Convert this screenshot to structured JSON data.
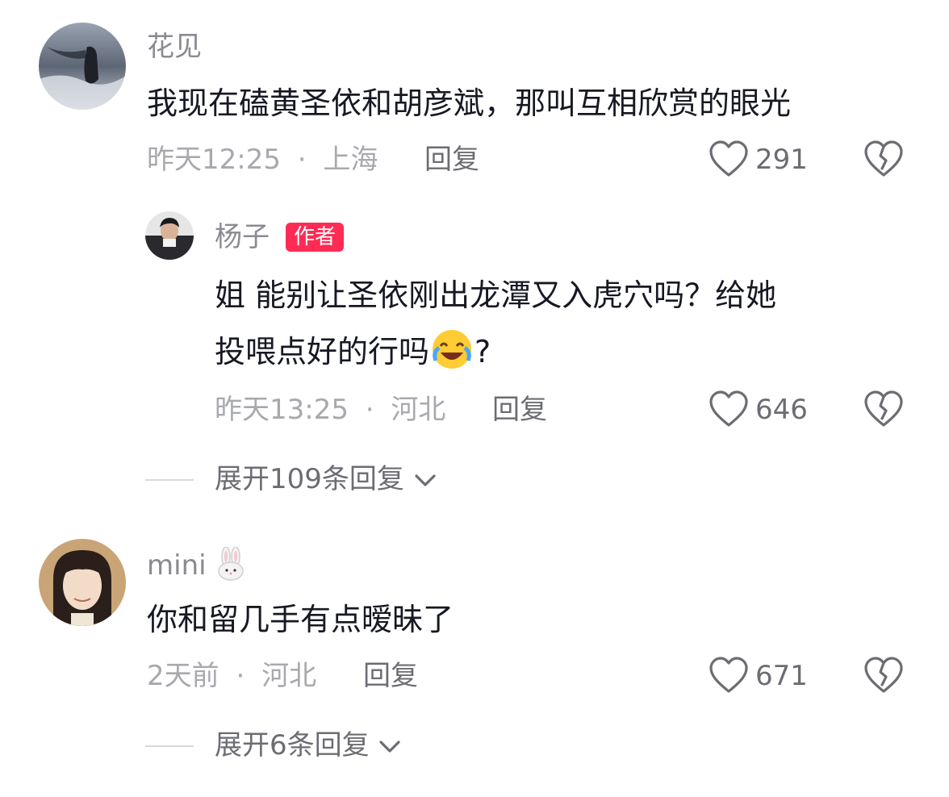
{
  "comments": [
    {
      "username": "花见",
      "text": "我现在磕黄圣依和胡彦斌，那叫互相欣赏的眼光",
      "time": "昨天12:25",
      "location": "上海",
      "reply_label": "回复",
      "likes": "291",
      "avatar": "silhouette-avatar",
      "replies": [
        {
          "username": "杨子",
          "badge": "作者",
          "text_line1": "姐 能别让圣依刚出龙潭又入虎穴吗？给她",
          "text_line2_before": "投喂点好的行吗",
          "emoji": "crying-laughing-emoji",
          "text_line2_after": "?",
          "time": "昨天13:25",
          "location": "河北",
          "reply_label": "回复",
          "likes": "646",
          "avatar": "man-portrait-avatar"
        }
      ],
      "expand_label": "展开109条回复"
    },
    {
      "username": "mini",
      "username_icon": "rabbit-emoji",
      "text": "你和留几手有点暧昧了",
      "time": "2天前",
      "location": "河北",
      "reply_label": "回复",
      "likes": "671",
      "avatar": "girl-portrait-avatar",
      "expand_label": "展开6条回复"
    }
  ],
  "separator": "·",
  "colors": {
    "text": "#161823",
    "meta": "#a8a9ae",
    "author_badge": "#fe2c55"
  }
}
